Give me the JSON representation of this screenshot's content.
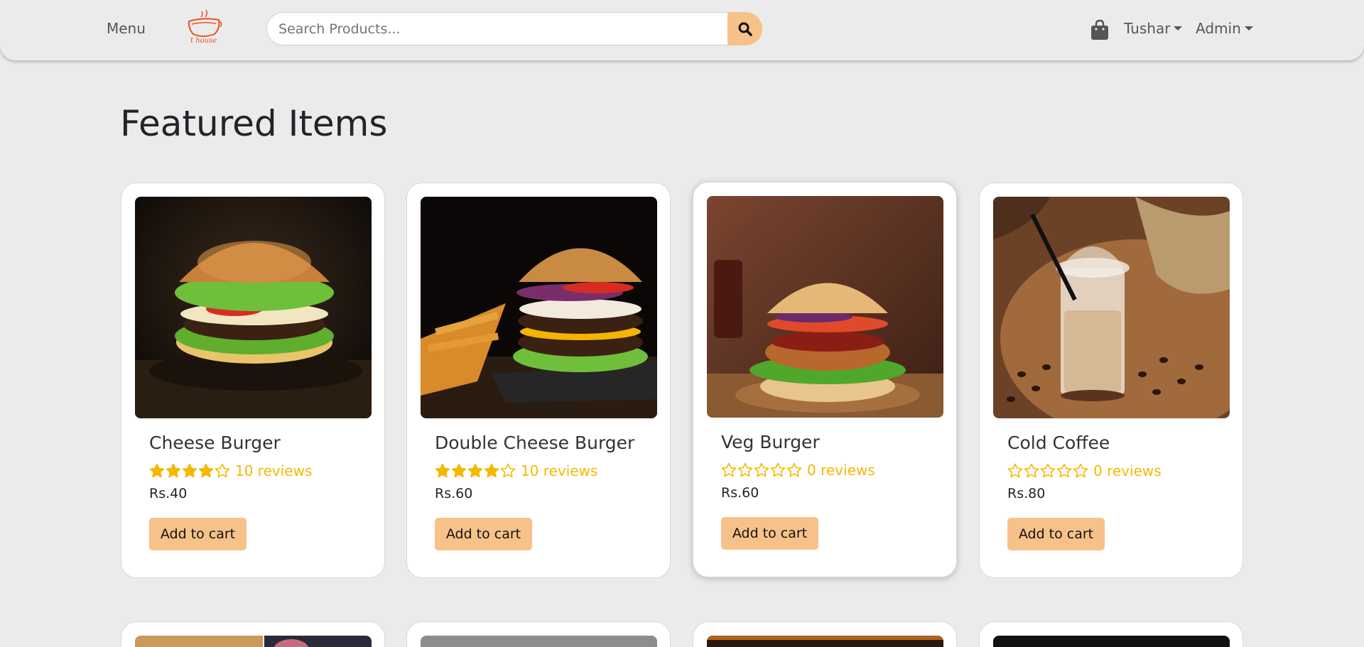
{
  "nav": {
    "menu_label": "Menu",
    "search_placeholder": "Search Products...",
    "user_label": "Tushar",
    "admin_label": "Admin"
  },
  "page": {
    "title": "Featured Items"
  },
  "products": [
    {
      "name": "Cheese Burger",
      "rating": 4,
      "reviews": "10 reviews",
      "price": "Rs.40",
      "button": "Add to cart"
    },
    {
      "name": "Double Cheese Burger",
      "rating": 4,
      "reviews": "10 reviews",
      "price": "Rs.60",
      "button": "Add to cart"
    },
    {
      "name": "Veg Burger",
      "rating": 0,
      "reviews": "0 reviews",
      "price": "Rs.60",
      "button": "Add to cart"
    },
    {
      "name": "Cold Coffee",
      "rating": 0,
      "reviews": "0 reviews",
      "price": "Rs.80",
      "button": "Add to cart"
    }
  ],
  "colors": {
    "accent": "#f7c28a",
    "star": "#f5b800",
    "background": "#ebebeb"
  }
}
